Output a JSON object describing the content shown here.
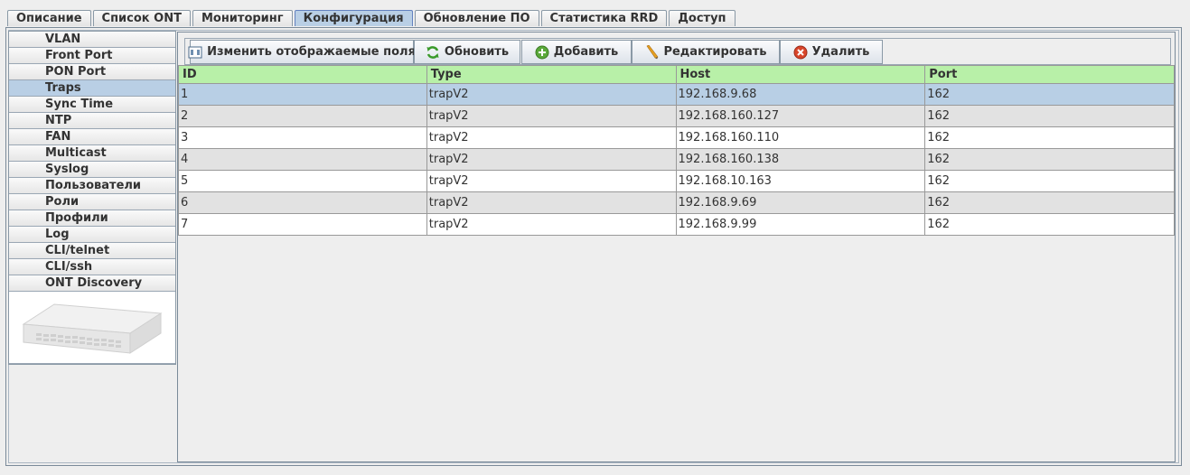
{
  "top_tabs": [
    {
      "label": "Описание",
      "active": false
    },
    {
      "label": "Список ONT",
      "active": false
    },
    {
      "label": "Мониторинг",
      "active": false
    },
    {
      "label": "Конфигурация",
      "active": true
    },
    {
      "label": "Обновление ПО",
      "active": false
    },
    {
      "label": "Статистика RRD",
      "active": false
    },
    {
      "label": "Доступ",
      "active": false
    }
  ],
  "sidebar": {
    "items": [
      {
        "label": "VLAN",
        "active": false
      },
      {
        "label": "Front Port",
        "active": false
      },
      {
        "label": "PON Port",
        "active": false
      },
      {
        "label": "Traps",
        "active": true
      },
      {
        "label": "Sync Time",
        "active": false
      },
      {
        "label": "NTP",
        "active": false
      },
      {
        "label": "FAN",
        "active": false
      },
      {
        "label": "Multicast",
        "active": false
      },
      {
        "label": "Syslog",
        "active": false
      },
      {
        "label": "Пользователи",
        "active": false
      },
      {
        "label": "Роли",
        "active": false
      },
      {
        "label": "Профили",
        "active": false
      },
      {
        "label": "Log",
        "active": false
      },
      {
        "label": "CLI/telnet",
        "active": false
      },
      {
        "label": "CLI/ssh",
        "active": false
      },
      {
        "label": "ONT Discovery",
        "active": false
      }
    ]
  },
  "toolbar": {
    "change_fields_label": "Изменить отображаемые поля",
    "refresh_label": "Обновить",
    "add_label": "Добавить",
    "edit_label": "Редактировать",
    "delete_label": "Удалить"
  },
  "table": {
    "columns": [
      "ID",
      "Type",
      "Host",
      "Port"
    ],
    "selected_row": 0,
    "rows": [
      [
        "1",
        "trapV2",
        "192.168.9.68",
        "162"
      ],
      [
        "2",
        "trapV2",
        "192.168.160.127",
        "162"
      ],
      [
        "3",
        "trapV2",
        "192.168.160.110",
        "162"
      ],
      [
        "4",
        "trapV2",
        "192.168.160.138",
        "162"
      ],
      [
        "5",
        "trapV2",
        "192.168.10.163",
        "162"
      ],
      [
        "6",
        "trapV2",
        "192.168.9.69",
        "162"
      ],
      [
        "7",
        "trapV2",
        "192.168.9.99",
        "162"
      ]
    ]
  },
  "colors": {
    "header_green": "#b8f0a8",
    "selection_blue": "#b8cfe5",
    "row_alt": "#e2e2e2"
  }
}
